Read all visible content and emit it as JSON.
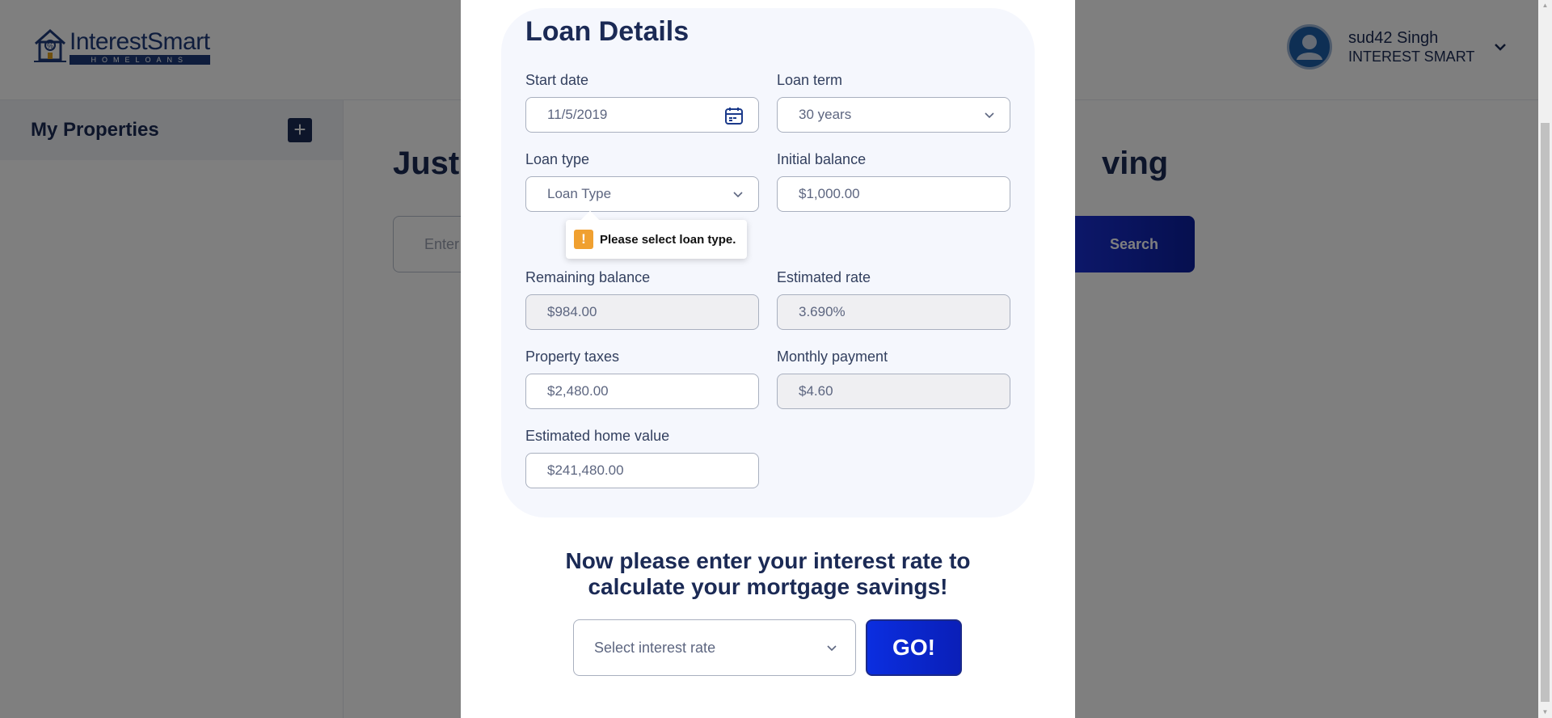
{
  "header": {
    "logo": {
      "brand": "InterestSmart",
      "sub": "HOMELOANS"
    },
    "user": {
      "name": "sud42 Singh",
      "org": "INTEREST SMART"
    }
  },
  "sidebar": {
    "title": "My Properties"
  },
  "main": {
    "heading_left": "Just",
    "heading_right": "ving",
    "search_placeholder": "Enter",
    "search_button": "Search"
  },
  "modal": {
    "title": "Loan Details",
    "fields": {
      "start_date": {
        "label": "Start date",
        "value": "11/5/2019"
      },
      "loan_term": {
        "label": "Loan term",
        "value": "30 years"
      },
      "loan_type": {
        "label": "Loan type",
        "value": "Loan Type"
      },
      "initial_balance": {
        "label": "Initial balance",
        "value": "$1,000.00"
      },
      "remaining_balance": {
        "label": "Remaining balance",
        "value": "$984.00"
      },
      "estimated_rate": {
        "label": "Estimated rate",
        "value": "3.690%"
      },
      "property_taxes": {
        "label": "Property taxes",
        "value": "$2,480.00"
      },
      "monthly_payment": {
        "label": "Monthly payment",
        "value": "$4.60"
      },
      "estimated_home_value": {
        "label": "Estimated home value",
        "value": "$241,480.00"
      }
    },
    "validation": {
      "icon": "!",
      "message": "Please select loan type."
    },
    "prompt_line1": "Now please enter your interest rate to",
    "prompt_line2": "calculate your mortgage savings!",
    "rate_select": {
      "value": "Select interest rate"
    },
    "go_button": "GO!"
  },
  "colors": {
    "primary": "#1b2a55",
    "accent": "#0b2ee0",
    "warning": "#f0a030",
    "card_bg": "#f5f7fd"
  },
  "icons": [
    "house-logo-icon",
    "plus-icon",
    "user-avatar-icon",
    "chevron-down-icon",
    "calendar-icon",
    "warning-icon"
  ]
}
